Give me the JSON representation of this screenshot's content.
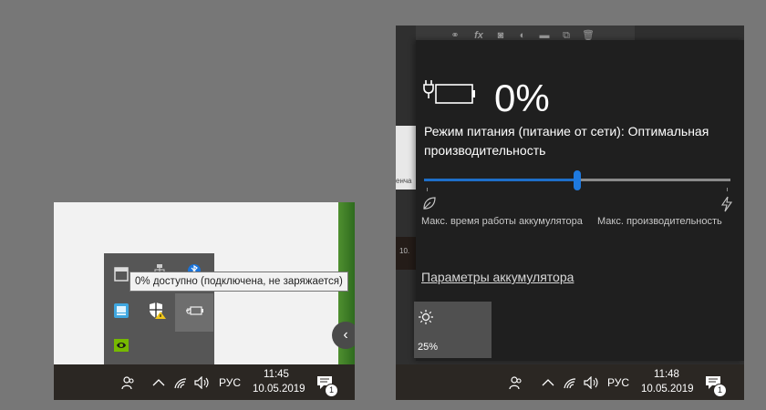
{
  "left_panel": {
    "tooltip": "0% доступно (подключена, не заряжается)",
    "taskbar": {
      "language": "РУС",
      "time": "11:45",
      "date": "10.05.2019",
      "notification_count": "1"
    }
  },
  "right_panel": {
    "battery_percent": "0%",
    "power_mode_text": "Режим питания (питание от сети): Оптимальная производительность",
    "slider": {
      "value_fraction": 0.5
    },
    "label_left": "Макс. время работы аккумулятора",
    "label_right": "Макс. производительность",
    "settings_link": "Параметры аккумулятора",
    "brightness_tile": {
      "value": "25%"
    },
    "toolbar_fx": "fx",
    "background_date_fragment": "10.",
    "background_text_fragment": "енча",
    "taskbar": {
      "language": "РУС",
      "time": "11:48",
      "date": "10.05.2019",
      "notification_count": "1"
    }
  },
  "colors": {
    "accent": "#1e7ae0",
    "flyout_bg": "#1f1f1f",
    "taskbar_bg": "#2b2723",
    "page_bg": "#777777"
  }
}
